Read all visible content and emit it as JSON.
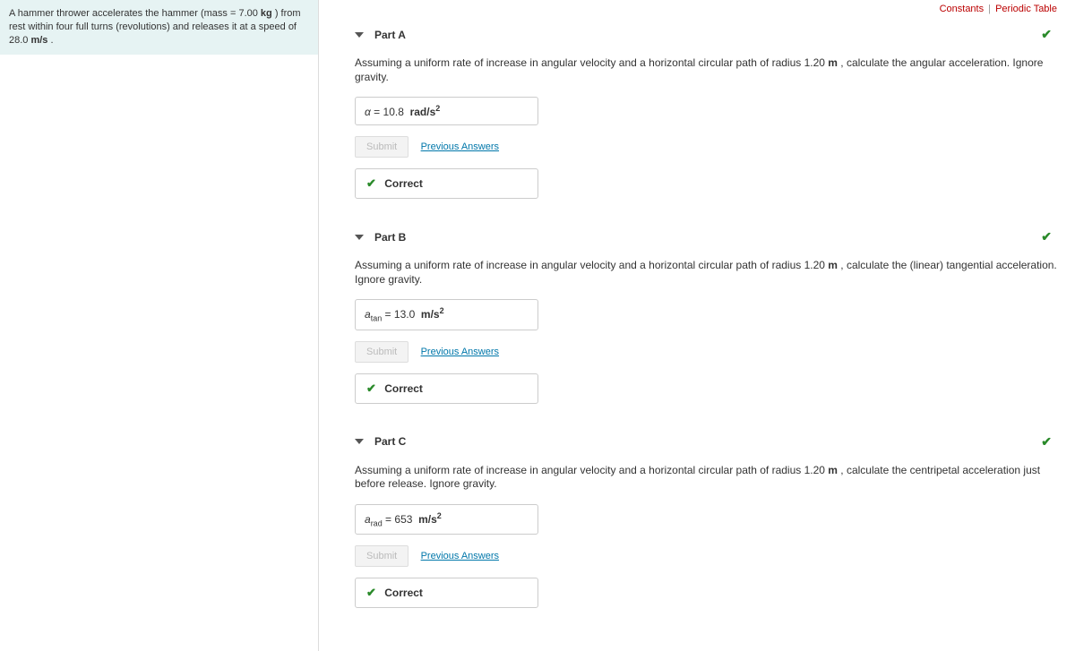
{
  "top_links": {
    "constants": "Constants",
    "periodic": "Periodic Table"
  },
  "problem": {
    "text_1": "A hammer thrower accelerates the hammer (mass = 7.00 ",
    "unit_1": "kg",
    "text_2": " ) from rest within four full turns (revolutions) and releases it at a speed of 28.0 ",
    "unit_2": "m/s",
    "text_3": " ."
  },
  "buttons": {
    "submit": "Submit",
    "previous": "Previous Answers",
    "correct": "Correct"
  },
  "parts": {
    "a": {
      "title": "Part A",
      "prompt_1": "Assuming a uniform rate of increase in angular velocity and a horizontal circular path of radius 1.20 ",
      "prompt_unit": "m",
      "prompt_2": " , calculate the angular acceleration. Ignore gravity.",
      "var": "α",
      "eq": " = ",
      "value": "10.8",
      "unit_base": "rad/s",
      "unit_exp": "2"
    },
    "b": {
      "title": "Part B",
      "prompt_1": "Assuming a uniform rate of increase in angular velocity and a horizontal circular path of radius 1.20 ",
      "prompt_unit": "m",
      "prompt_2": " , calculate the (linear) tangential acceleration. Ignore gravity.",
      "var_base": "a",
      "var_sub": "tan",
      "eq": " = ",
      "value": "13.0",
      "unit_base": "m/s",
      "unit_exp": "2"
    },
    "c": {
      "title": "Part C",
      "prompt_1": "Assuming a uniform rate of increase in angular velocity and a horizontal circular path of radius 1.20 ",
      "prompt_unit": "m",
      "prompt_2": " , calculate the centripetal acceleration just before release. Ignore gravity.",
      "var_base": "a",
      "var_sub": "rad",
      "eq": " = ",
      "value": "653",
      "unit_base": "m/s",
      "unit_exp": "2"
    }
  }
}
